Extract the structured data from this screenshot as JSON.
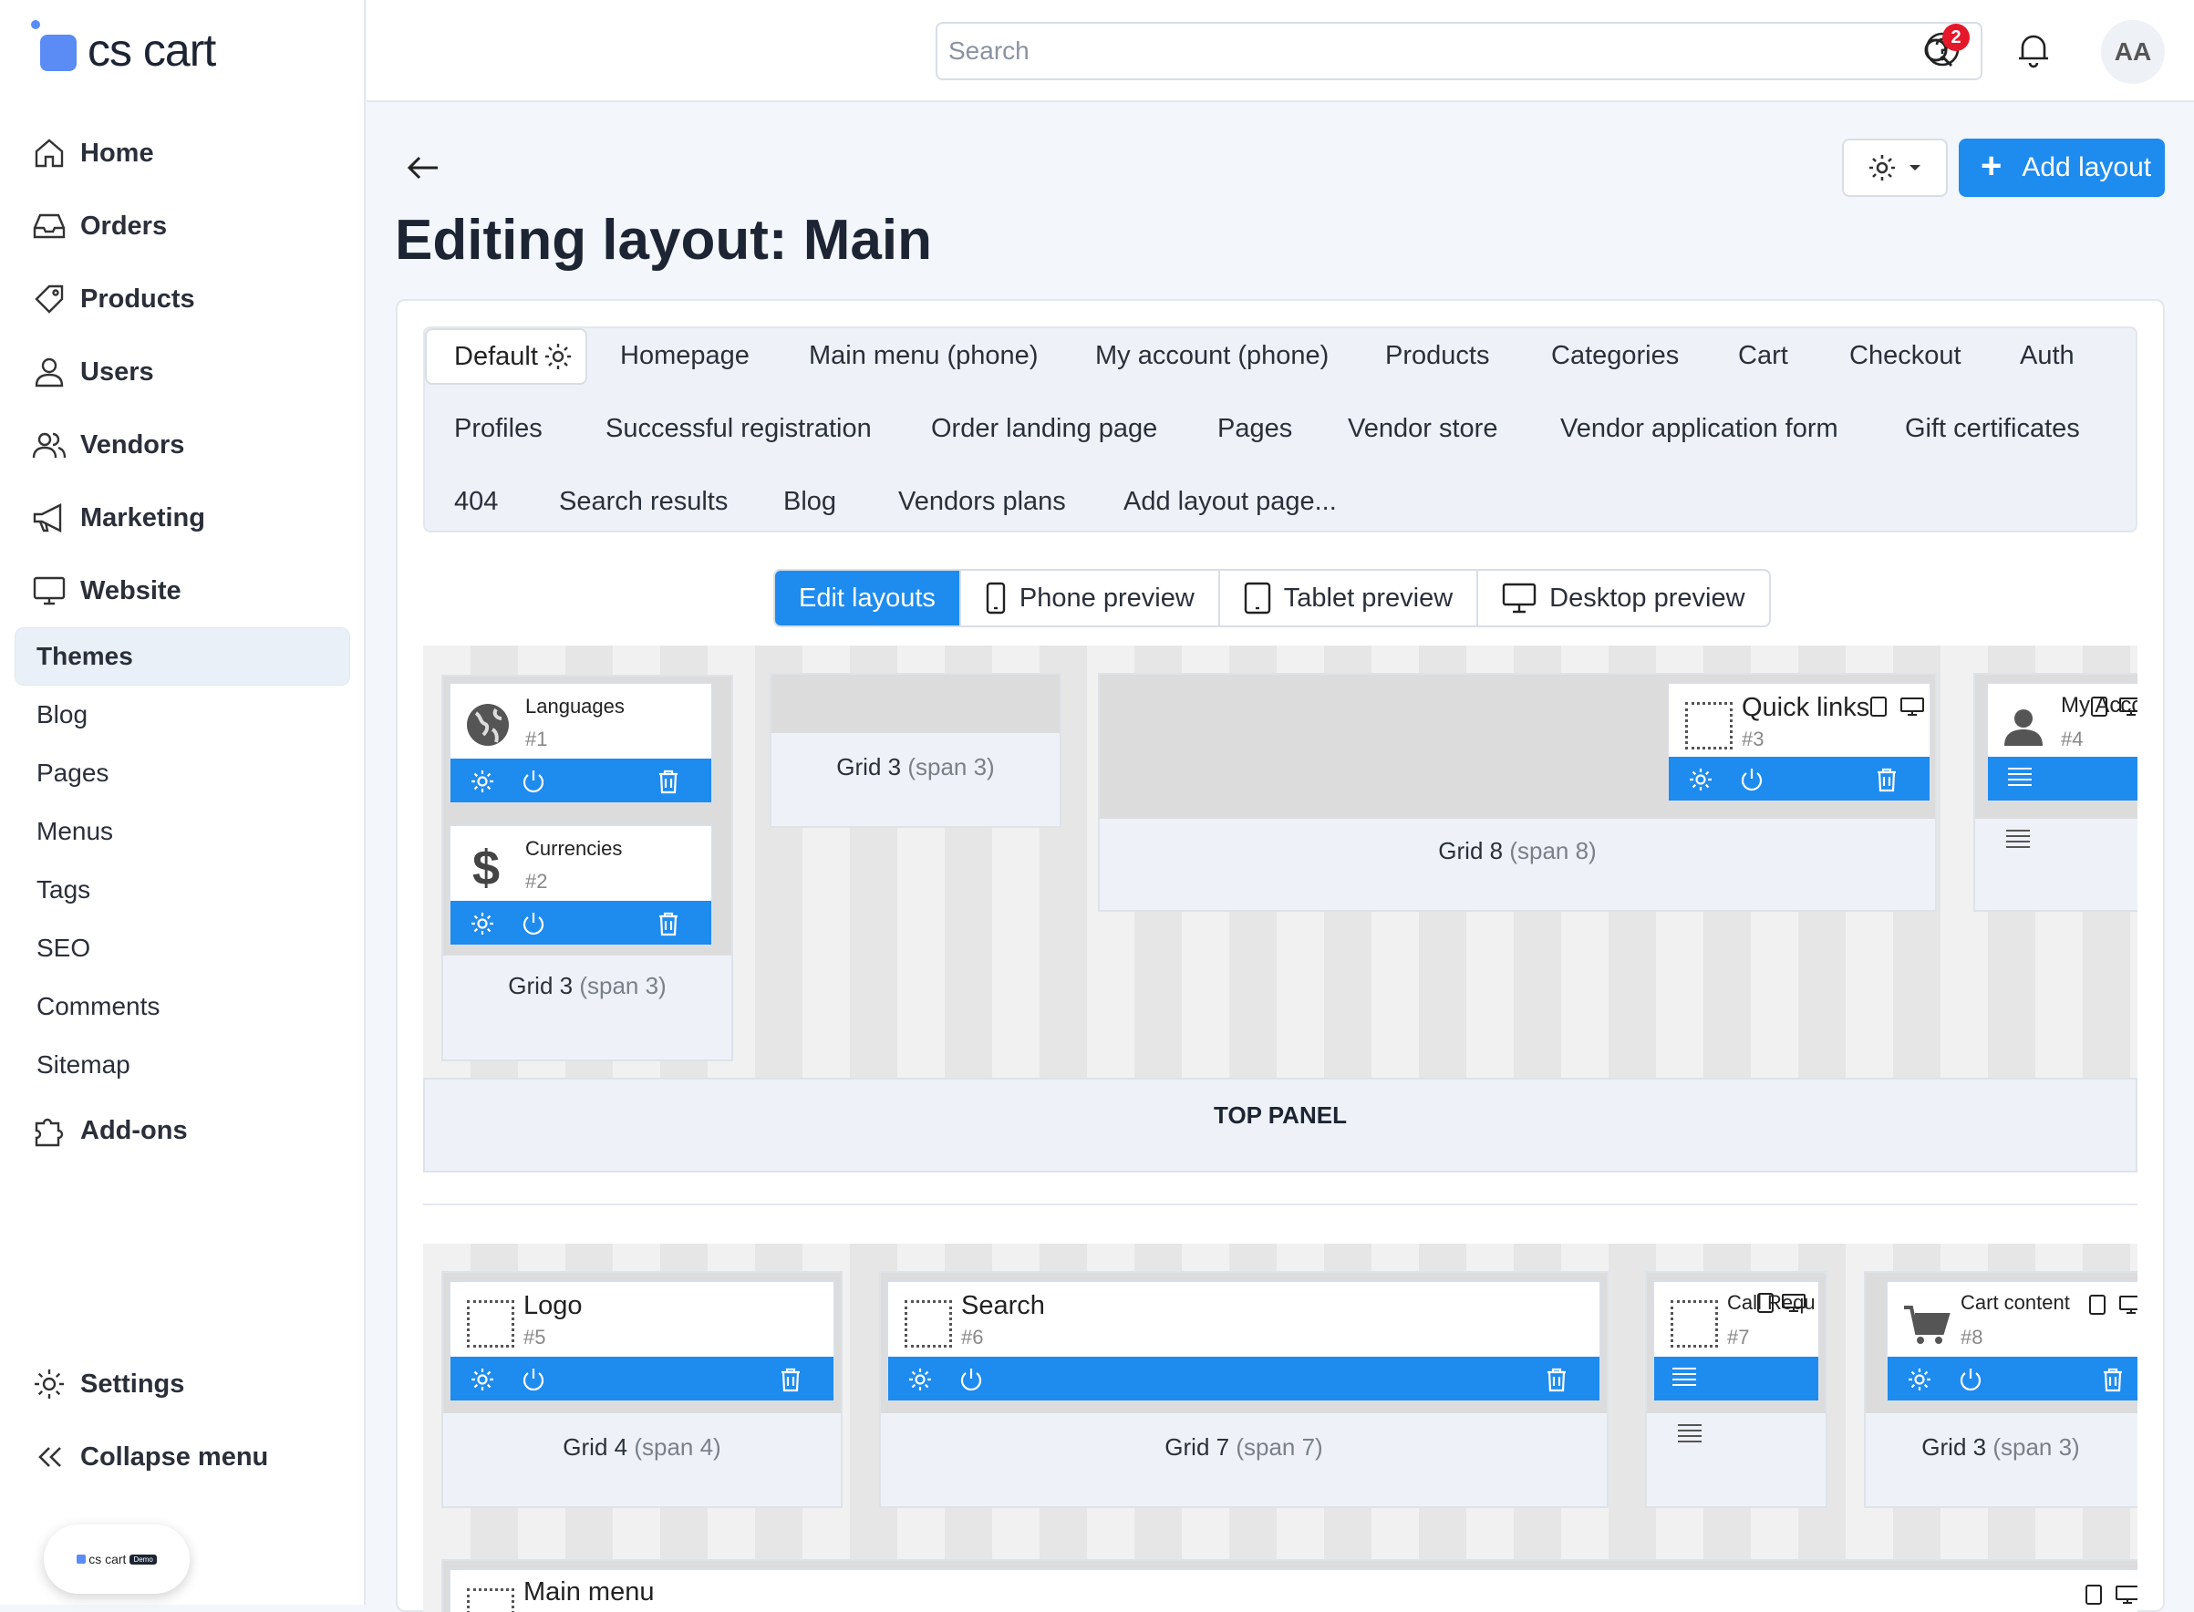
{
  "brand": {
    "logo_text": "cs cart",
    "badge_text": "cs cart",
    "badge_tag": "Demo"
  },
  "sidebar": {
    "main_items": [
      {
        "label": "Home",
        "icon": "home-icon"
      },
      {
        "label": "Orders",
        "icon": "inbox-icon"
      },
      {
        "label": "Products",
        "icon": "tag-icon"
      },
      {
        "label": "Users",
        "icon": "user-icon"
      },
      {
        "label": "Vendors",
        "icon": "users-icon"
      },
      {
        "label": "Marketing",
        "icon": "megaphone-icon"
      },
      {
        "label": "Website",
        "icon": "monitor-icon"
      }
    ],
    "sub_items": [
      "Themes",
      "Blog",
      "Pages",
      "Menus",
      "Tags",
      "SEO",
      "Comments",
      "Sitemap"
    ],
    "addons": "Add-ons",
    "settings": "Settings",
    "collapse": "Collapse menu"
  },
  "header": {
    "search_placeholder": "Search",
    "help_badge": "2",
    "avatar": "AA"
  },
  "page": {
    "title": "Editing layout: Main",
    "add_layout": "Add layout"
  },
  "tabs": {
    "row1": [
      "Default",
      "Homepage",
      "Main menu (phone)",
      "My account (phone)",
      "Products",
      "Categories",
      "Cart",
      "Checkout",
      "Auth"
    ],
    "row2": [
      "Profiles",
      "Successful registration",
      "Order landing page",
      "Pages",
      "Vendor store",
      "Vendor application form",
      "Gift certificates"
    ],
    "row3": [
      "404",
      "Search results",
      "Blog",
      "Vendors plans",
      "Add layout page..."
    ]
  },
  "preview": {
    "edit": "Edit layouts",
    "phone": "Phone preview",
    "tablet": "Tablet preview",
    "desktop": "Desktop preview"
  },
  "layout": {
    "top_panel_label": "TOP PANEL",
    "top_grids": [
      {
        "name": "Grid 3",
        "span": "(span 3)"
      },
      {
        "name": "Grid 3",
        "span": "(span 3)"
      },
      {
        "name": "Grid 8",
        "span": "(span 8)"
      }
    ],
    "header_grids": [
      {
        "name": "Grid 4",
        "span": "(span 4)"
      },
      {
        "name": "Grid 7",
        "span": "(span 7)"
      },
      {
        "name": "Grid 3",
        "span": "(span 3)"
      }
    ],
    "blocks": [
      {
        "name": "Languages",
        "num": "#1",
        "icon": "globe-icon"
      },
      {
        "name": "Currencies",
        "num": "#2",
        "icon": "dollar-icon"
      },
      {
        "name": "Quick links",
        "num": "#3",
        "icon": "placeholder-icon"
      },
      {
        "name": "My Acco",
        "num": "#4",
        "icon": "person-icon"
      },
      {
        "name": "Logo",
        "num": "#5",
        "icon": "placeholder-icon"
      },
      {
        "name": "Search",
        "num": "#6",
        "icon": "placeholder-icon"
      },
      {
        "name": "Call Requ",
        "num": "#7",
        "icon": "placeholder-icon"
      },
      {
        "name": "Cart content",
        "num": "#8",
        "icon": "cart-icon"
      },
      {
        "name": "Main menu",
        "num": "",
        "icon": "placeholder-icon"
      }
    ]
  },
  "colors": {
    "accent": "#1e8bef",
    "badge": "#e5172b",
    "brand": "#5b8cf5"
  }
}
